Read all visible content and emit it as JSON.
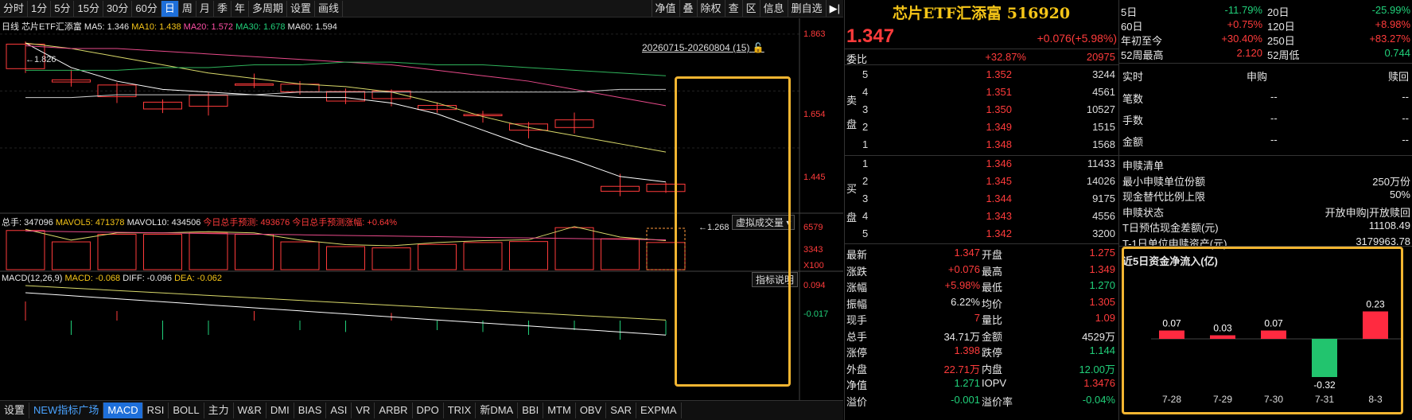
{
  "periods": [
    "分时",
    "1分",
    "5分",
    "15分",
    "30分",
    "60分",
    "日",
    "周",
    "月",
    "季",
    "年",
    "多周期",
    "设置",
    "画线"
  ],
  "active_period": "日",
  "toolbar": [
    "净值",
    "叠",
    "除权",
    "查",
    "区",
    "信息",
    "删自选"
  ],
  "chart_header": {
    "label": "日线",
    "name": "芯片ETF汇添富",
    "ma5": "MA5: 1.346",
    "ma10": "MA10: 1.438",
    "ma20": "MA20: 1.572",
    "ma30": "MA30: 1.678",
    "ma60": "MA60: 1.594"
  },
  "range_label": "20260715-20260804 (15)",
  "price_axis": [
    "1.863",
    "1.654",
    "1.445"
  ],
  "hi_label": "1.826",
  "lo_label": "1.268",
  "candles": [
    {
      "o": 1.736,
      "c": 1.826,
      "h": 1.836,
      "l": 1.72
    },
    {
      "o": 1.687,
      "c": 1.695,
      "h": 1.733,
      "l": 1.67
    },
    {
      "o": 1.633,
      "c": 1.676,
      "h": 1.685,
      "l": 1.61
    },
    {
      "o": 1.588,
      "c": 1.613,
      "h": 1.623,
      "l": 1.573
    },
    {
      "o": 1.598,
      "c": 1.638,
      "h": 1.648,
      "l": 1.564
    },
    {
      "o": 1.675,
      "c": 1.68,
      "h": 1.718,
      "l": 1.665
    },
    {
      "o": 1.651,
      "c": 1.679,
      "h": 1.69,
      "l": 1.641
    },
    {
      "o": 1.617,
      "c": 1.652,
      "h": 1.663,
      "l": 1.606
    },
    {
      "o": 1.626,
      "c": 1.654,
      "h": 1.66,
      "l": 1.598
    },
    {
      "o": 1.586,
      "c": 1.601,
      "h": 1.612,
      "l": 1.574
    },
    {
      "o": 1.563,
      "c": 1.568,
      "h": 1.581,
      "l": 1.538
    },
    {
      "o": 1.51,
      "c": 1.533,
      "h": 1.54,
      "l": 1.48
    },
    {
      "o": 1.52,
      "c": 1.548,
      "h": 1.575,
      "l": 1.498
    },
    {
      "o": 1.286,
      "c": 1.304,
      "h": 1.35,
      "l": 1.268
    },
    {
      "o": 1.285,
      "c": 1.312,
      "h": 1.318,
      "l": 1.28
    }
  ],
  "ma_lines": {
    "white": [
      1.83,
      1.74,
      1.69,
      1.66,
      1.65,
      1.64,
      1.63,
      1.63,
      1.61,
      1.57,
      1.51,
      1.45,
      1.4,
      1.34,
      1.32
    ],
    "yellow": [
      1.83,
      1.81,
      1.78,
      1.75,
      1.72,
      1.7,
      1.68,
      1.67,
      1.65,
      1.61,
      1.56,
      1.52,
      1.49,
      1.46,
      1.43
    ],
    "pink": [
      1.82,
      1.81,
      1.81,
      1.8,
      1.79,
      1.78,
      1.77,
      1.76,
      1.75,
      1.73,
      1.71,
      1.69,
      1.66,
      1.63,
      1.6
    ],
    "green": [
      1.73,
      1.73,
      1.73,
      1.74,
      1.74,
      1.75,
      1.75,
      1.76,
      1.76,
      1.75,
      1.75,
      1.74,
      1.73,
      1.72,
      1.71
    ],
    "gray": [
      1.63,
      1.63,
      1.64,
      1.64,
      1.64,
      1.64,
      1.65,
      1.65,
      1.65,
      1.65,
      1.65,
      1.65,
      1.65,
      1.66,
      1.66
    ]
  },
  "vol_header": {
    "total": "总手: 347096",
    "vol5": "MAVOL5: 471378",
    "vol10": "MAVOL10: 434506",
    "pred": "今日总手预测: 493676",
    "pred_chg": "今日总手预测涨幅: +0.64%"
  },
  "vol_axis": [
    "6579",
    "3343",
    "X100"
  ],
  "virtual_btn": "虚拟成交量",
  "volumes": [
    620,
    440,
    560,
    560,
    580,
    560,
    440,
    365,
    345,
    400,
    430,
    445,
    665,
    490,
    430
  ],
  "macd_header": {
    "title": "MACD(12,26,9)",
    "macd": "MACD: -0.068",
    "diff": "DIFF: -0.096",
    "dea": "DEA: -0.062"
  },
  "macd_axis": [
    "0.094",
    "-0.017"
  ],
  "indicator_btn": "指标说明",
  "macd_bars": [
    0.02,
    -0.015,
    0.01,
    -0.02,
    -0.015,
    0.01,
    -0.01,
    -0.012,
    0.008,
    -0.01,
    -0.012,
    -0.015,
    -0.01,
    -0.02,
    -0.015
  ],
  "bottom_tabs": [
    "设置",
    "NEW指标广场",
    "MACD",
    "RSI",
    "BOLL",
    "主力",
    "W&R",
    "DMI",
    "BIAS",
    "ASI",
    "VR",
    "ARBR",
    "DPO",
    "TRIX",
    "新DMA",
    "BBI",
    "MTM",
    "OBV",
    "SAR",
    "EXPMA"
  ],
  "active_tab": "MACD",
  "quote": {
    "title": "芯片ETF汇添富 516920",
    "price": "1.347",
    "change": "+0.076(+5.98%)",
    "weibi_label": "委比",
    "weibi_val": "+32.87%",
    "weibi_num": "20975",
    "sell_label": [
      "卖",
      "盘"
    ],
    "buy_label": [
      "买",
      "盘"
    ],
    "asks": [
      {
        "n": "5",
        "p": "1.352",
        "v": "3244"
      },
      {
        "n": "4",
        "p": "1.351",
        "v": "4561"
      },
      {
        "n": "3",
        "p": "1.350",
        "v": "10527"
      },
      {
        "n": "2",
        "p": "1.349",
        "v": "1515"
      },
      {
        "n": "1",
        "p": "1.348",
        "v": "1568"
      }
    ],
    "bids": [
      {
        "n": "1",
        "p": "1.346",
        "v": "11433"
      },
      {
        "n": "2",
        "p": "1.345",
        "v": "14026"
      },
      {
        "n": "3",
        "p": "1.344",
        "v": "9175"
      },
      {
        "n": "4",
        "p": "1.343",
        "v": "4556"
      },
      {
        "n": "5",
        "p": "1.342",
        "v": "3200"
      }
    ],
    "stats": [
      {
        "l1": "最新",
        "v1": "1.347",
        "c1": "red",
        "l2": "开盘",
        "v2": "1.275",
        "c2": "red"
      },
      {
        "l1": "涨跌",
        "v1": "+0.076",
        "c1": "red",
        "l2": "最高",
        "v2": "1.349",
        "c2": "red"
      },
      {
        "l1": "涨幅",
        "v1": "+5.98%",
        "c1": "red",
        "l2": "最低",
        "v2": "1.270",
        "c2": "green"
      },
      {
        "l1": "振幅",
        "v1": "6.22%",
        "c1": "white",
        "l2": "均价",
        "v2": "1.305",
        "c2": "red"
      },
      {
        "l1": "现手",
        "v1": "7",
        "c1": "red",
        "l2": "量比",
        "v2": "1.09",
        "c2": "red"
      },
      {
        "l1": "总手",
        "v1": "34.71万",
        "c1": "white",
        "l2": "金额",
        "v2": "4529万",
        "c2": "white"
      },
      {
        "l1": "涨停",
        "v1": "1.398",
        "c1": "red",
        "l2": "跌停",
        "v2": "1.144",
        "c2": "green"
      },
      {
        "l1": "外盘",
        "v1": "22.71万",
        "c1": "red",
        "l2": "内盘",
        "v2": "12.00万",
        "c2": "green"
      },
      {
        "l1": "净值",
        "v1": "1.271",
        "c1": "green",
        "l2": "IOPV",
        "v2": "1.3476",
        "c2": "red"
      },
      {
        "l1": "溢价",
        "v1": "-0.001",
        "c1": "green",
        "l2": "溢价率",
        "v2": "-0.04%",
        "c2": "green"
      }
    ]
  },
  "perf": [
    {
      "l1": "5日",
      "v1": "-11.79%",
      "c1": "green",
      "l2": "20日",
      "v2": "-25.99%",
      "c2": "green"
    },
    {
      "l1": "60日",
      "v1": "+0.75%",
      "c1": "red",
      "l2": "120日",
      "v2": "+8.98%",
      "c2": "red"
    },
    {
      "l1": "年初至今",
      "v1": "+30.40%",
      "c1": "red",
      "l2": "250日",
      "v2": "+83.27%",
      "c2": "red"
    },
    {
      "l1": "52周最高",
      "v1": "2.120",
      "c1": "red",
      "l2": "52周低",
      "v2": "0.744",
      "c2": "green"
    }
  ],
  "realtime": {
    "head": [
      "实时",
      "申购",
      "赎回"
    ],
    "rows": [
      {
        "l": "笔数",
        "a": "--",
        "b": "--"
      },
      {
        "l": "手数",
        "a": "--",
        "b": "--"
      },
      {
        "l": "金额",
        "a": "--",
        "b": "--"
      }
    ]
  },
  "etf_info": [
    {
      "l": "申赎清单",
      "v": ""
    },
    {
      "l": "最小申赎单位份额",
      "v": "250万份"
    },
    {
      "l": "现金替代比例上限",
      "v": "50%"
    },
    {
      "l": "申赎状态",
      "v": "开放申购|开放赎回"
    },
    {
      "l": "T日预估现金差额(元)",
      "v": "11108.49"
    },
    {
      "l": "T-1日单位申赎资产(元)",
      "v": "3179963.78"
    }
  ],
  "flow": {
    "title": "近5日资金净流入(亿)",
    "categories": [
      "7-28",
      "7-29",
      "7-30",
      "7-31",
      "8-3"
    ],
    "values": [
      0.07,
      0.03,
      0.07,
      -0.32,
      0.23
    ],
    "labels": [
      "0.07",
      "0.03",
      "0.07",
      "-0.32",
      "0.23"
    ],
    "pos_color": "#ff2a40",
    "neg_color": "#22c46e"
  },
  "chart_data": {
    "type": "bar",
    "title": "近5日资金净流入(亿)",
    "categories": [
      "7-28",
      "7-29",
      "7-30",
      "7-31",
      "8-3"
    ],
    "values": [
      0.07,
      0.03,
      0.07,
      -0.32,
      0.23
    ]
  }
}
